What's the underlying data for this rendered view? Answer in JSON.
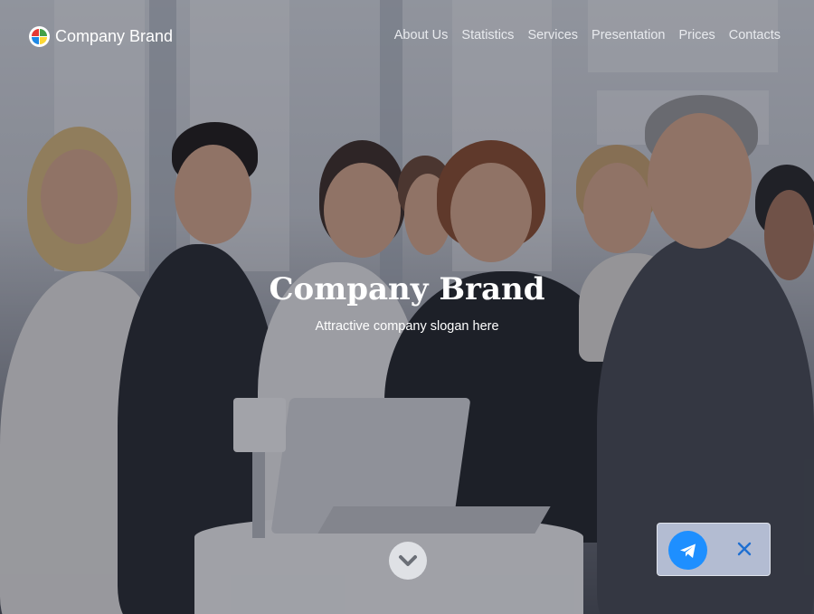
{
  "brand": {
    "name": "Company Brand",
    "logo_colors": [
      "#e53935",
      "#43a047",
      "#1e88e5",
      "#fdd835"
    ]
  },
  "nav": {
    "items": [
      {
        "label": "About Us"
      },
      {
        "label": "Statistics"
      },
      {
        "label": "Services"
      },
      {
        "label": "Presentation"
      },
      {
        "label": "Prices"
      },
      {
        "label": "Contacts"
      }
    ]
  },
  "hero": {
    "title": "Company Brand",
    "slogan": "Attractive company slogan here",
    "scroll_icon": "chevron-down-icon"
  },
  "widget": {
    "send_icon": "telegram-icon",
    "close_icon": "close-icon",
    "accent": "#1e8fff"
  }
}
